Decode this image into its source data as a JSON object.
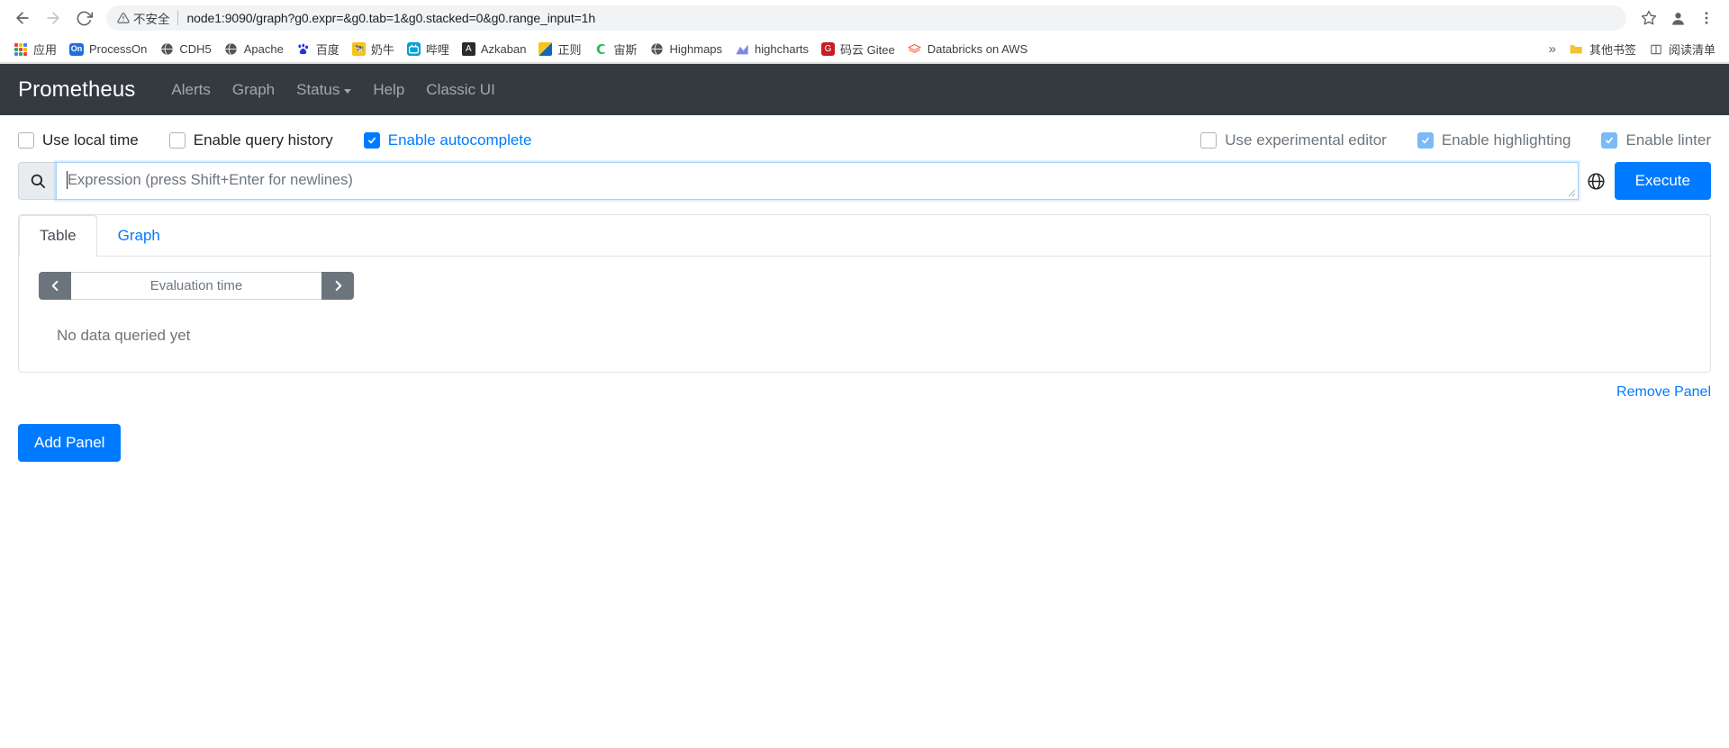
{
  "browser": {
    "back_icon": "back-arrow-icon",
    "forward_icon": "forward-arrow-icon",
    "reload_icon": "reload-icon",
    "security_warning": "不安全",
    "url_host": "node1:9090",
    "url_path": "/graph?g0.expr=&g0.tab=1&g0.stacked=0&g0.range_input=1h",
    "url_full": "node1:9090/graph?g0.expr=&g0.tab=1&g0.stacked=0&g0.range_input=1h",
    "star_icon": "bookmark-star-icon",
    "profile_icon": "profile-avatar-icon",
    "menu_icon": "three-dot-menu-icon",
    "overflow_label": "»"
  },
  "bookmarks": [
    {
      "label": "应用",
      "icon": "apps-grid-icon"
    },
    {
      "label": "ProcessOn",
      "icon": "processon-icon"
    },
    {
      "label": "CDH5",
      "icon": "globe-icon"
    },
    {
      "label": "Apache",
      "icon": "globe-icon"
    },
    {
      "label": "百度",
      "icon": "baidu-icon"
    },
    {
      "label": "奶牛",
      "icon": "niuniu-icon"
    },
    {
      "label": "哔哩",
      "icon": "bilibili-icon"
    },
    {
      "label": "Azkaban",
      "icon": "azkaban-icon"
    },
    {
      "label": "正则",
      "icon": "regex-icon"
    },
    {
      "label": "宙斯",
      "icon": "zeus-icon"
    },
    {
      "label": "Highmaps",
      "icon": "globe-icon"
    },
    {
      "label": "highcharts",
      "icon": "highcharts-icon"
    },
    {
      "label": "码云 Gitee",
      "icon": "gitee-icon"
    },
    {
      "label": "Databricks on AWS",
      "icon": "databricks-icon"
    }
  ],
  "bookmarks_right": [
    {
      "label": "其他书签",
      "icon": "folder-icon"
    },
    {
      "label": "阅读清单",
      "icon": "reading-list-icon"
    }
  ],
  "prometheus": {
    "brand": "Prometheus",
    "nav": [
      {
        "label": "Alerts",
        "has_caret": false
      },
      {
        "label": "Graph",
        "has_caret": false
      },
      {
        "label": "Status",
        "has_caret": true
      },
      {
        "label": "Help",
        "has_caret": false
      },
      {
        "label": "Classic UI",
        "has_caret": false
      }
    ]
  },
  "options": {
    "left": [
      {
        "label": "Use local time",
        "checked": false,
        "disabled": false
      },
      {
        "label": "Enable query history",
        "checked": false,
        "disabled": false
      },
      {
        "label": "Enable autocomplete",
        "checked": true,
        "disabled": false
      }
    ],
    "right": [
      {
        "label": "Use experimental editor",
        "checked": false,
        "disabled": false
      },
      {
        "label": "Enable highlighting",
        "checked": true,
        "disabled": true
      },
      {
        "label": "Enable linter",
        "checked": true,
        "disabled": true
      }
    ]
  },
  "expression": {
    "search_icon": "search-magnifier-icon",
    "placeholder": "Expression (press Shift+Enter for newlines)",
    "value": "",
    "globe_icon": "metrics-explorer-globe-icon",
    "execute_label": "Execute"
  },
  "panel": {
    "tabs": [
      {
        "label": "Table",
        "active": true
      },
      {
        "label": "Graph",
        "active": false
      }
    ],
    "eval_prev_icon": "chevron-left-icon",
    "eval_next_icon": "chevron-right-icon",
    "eval_placeholder": "Evaluation time",
    "eval_value": "",
    "no_data_message": "No data queried yet",
    "remove_panel_label": "Remove Panel"
  },
  "actions": {
    "add_panel_label": "Add Panel"
  },
  "colors": {
    "navbar_bg": "#343a40",
    "primary": "#007bff",
    "muted": "#6c757d",
    "border": "#dee2e6"
  }
}
